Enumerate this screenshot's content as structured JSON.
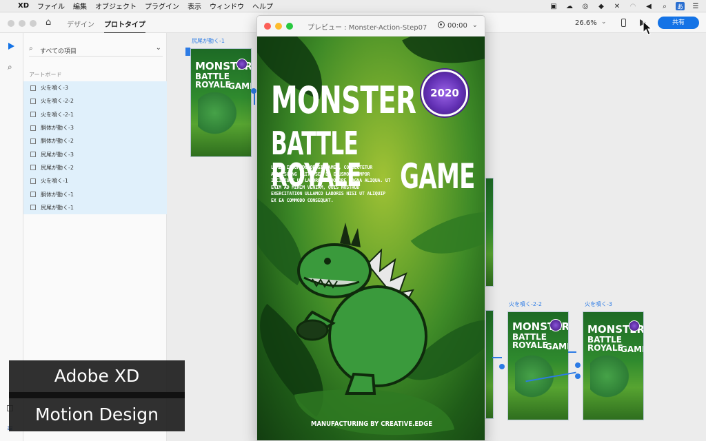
{
  "menubar": {
    "app": "XD",
    "items": [
      "ファイル",
      "編集",
      "オブジェクト",
      "プラグイン",
      "表示",
      "ウィンドウ",
      "ヘルプ"
    ],
    "ime": "あ"
  },
  "toolbar": {
    "tabs": [
      "デザイン",
      "プロトタイプ"
    ],
    "zoom": "26.6%",
    "share_label": "共有"
  },
  "layers": {
    "search_placeholder": "すべての項目",
    "section": "アートボード",
    "items": [
      "火を噴く-3",
      "火を噴く-2-2",
      "火を噴く-2-1",
      "胴体が動く-3",
      "胴体が動く-2",
      "尻尾が動く-3",
      "尻尾が動く-2",
      "火を噴く-1",
      "胴体が動く-1",
      "尻尾が動く-1"
    ]
  },
  "canvas": {
    "labels": [
      "尻尾が動く-1",
      "火を噴く-2-2",
      "火を噴く-3"
    ],
    "thumb_title": [
      "MONSTER",
      "BATTLE ROYALE",
      "GAME"
    ]
  },
  "preview": {
    "title": "プレビュー : Monster-Action-Step07",
    "timer": "00:00",
    "game": {
      "title1": "MONSTER",
      "title2": "BATTLE ROYALE",
      "title3": "GAME",
      "badge": "2020",
      "body": "LOREM IPSUM DOLOR SIT AMET, CONSECTETUR ADIPISCING ELIT, SED DO EIUSMOD TEMPOR INCIDIUNT UT LABORE ET DOLORE MAGNA ALIQUA. UT ENIM AD MINIM VENIAM, QUIS NOSTRUD EXERCITATION ULLAMCO LABORIS NISI UT ALIQUIP EX EA COMMODO CONSEQUAT.",
      "footer": "MANUFACTURING BY CREATIVE.EDGE"
    }
  },
  "overlay": {
    "line1": "Adobe XD",
    "line2": "Motion Design"
  }
}
